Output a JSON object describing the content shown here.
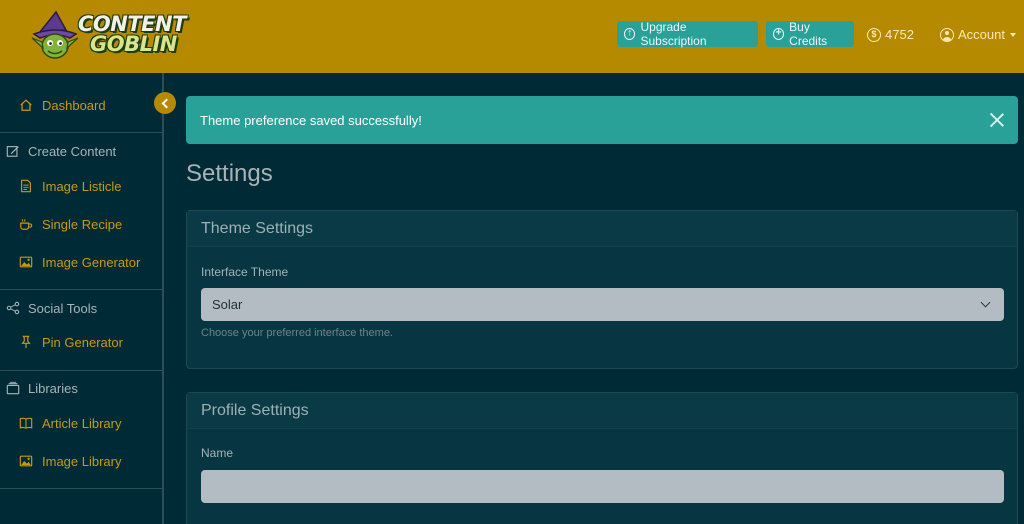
{
  "brand": {
    "logo_line1": "CONTENT",
    "logo_line2": "GOBLIN"
  },
  "header": {
    "upgrade_label": "Upgrade Subscription",
    "buy_credits_label": "Buy Credits",
    "credits": "4752",
    "account_label": "Account"
  },
  "sidebar": {
    "dashboard": "Dashboard",
    "sections": [
      {
        "title": "Create Content",
        "items": [
          "Image Listicle",
          "Single Recipe",
          "Image Generator"
        ]
      },
      {
        "title": "Social Tools",
        "items": [
          "Pin Generator"
        ]
      },
      {
        "title": "Libraries",
        "items": [
          "Article Library",
          "Image Library"
        ]
      }
    ]
  },
  "alert": {
    "message": "Theme preference saved successfully!"
  },
  "page": {
    "title": "Settings"
  },
  "theme_card": {
    "title": "Theme Settings",
    "field_label": "Interface Theme",
    "selected": "Solar",
    "help": "Choose your preferred interface theme."
  },
  "profile_card": {
    "title": "Profile Settings",
    "name_label": "Name",
    "name_value": ""
  },
  "colors": {
    "header": "#b58900",
    "accent": "#2aa198",
    "background": "#002b36",
    "card": "#073642"
  }
}
